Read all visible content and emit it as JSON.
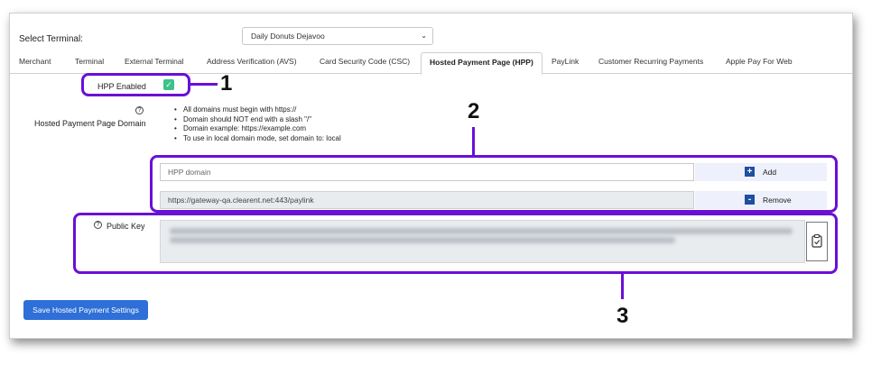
{
  "header": {
    "select_terminal_label": "Select Terminal:",
    "terminal_value": "Daily Donuts Dejavoo"
  },
  "tabs": [
    {
      "label": "Merchant"
    },
    {
      "label": "Terminal"
    },
    {
      "label": "External Terminal"
    },
    {
      "label": "Address Verification (AVS)"
    },
    {
      "label": "Card Security Code (CSC)"
    },
    {
      "label": "Hosted Payment Page (HPP)",
      "active": true
    },
    {
      "label": "PayLink"
    },
    {
      "label": "Customer Recurring Payments"
    },
    {
      "label": "Apple Pay For Web"
    }
  ],
  "hpp": {
    "enabled_label": "HPP Enabled",
    "enabled": true,
    "domain_label": "Hosted Payment Page Domain",
    "rules": [
      "All domains must begin with https://",
      "Domain should NOT end with a slash \"/\"",
      "Domain example: https://example.com",
      "To use in local domain mode, set domain to: local"
    ],
    "domain_input_placeholder": "HPP domain",
    "add_label": "Add",
    "domains": [
      {
        "value": "https://gateway-qa.clearent.net:443/paylink",
        "remove_label": "Remove"
      }
    ],
    "public_key_label": "Public Key"
  },
  "footer": {
    "save_label": "Save Hosted Payment Settings"
  },
  "annotations": [
    "1",
    "2",
    "3"
  ],
  "colors": {
    "highlight": "#6a0fd6",
    "primary_button": "#2e6fd8",
    "checkbox": "#3cc28a"
  }
}
